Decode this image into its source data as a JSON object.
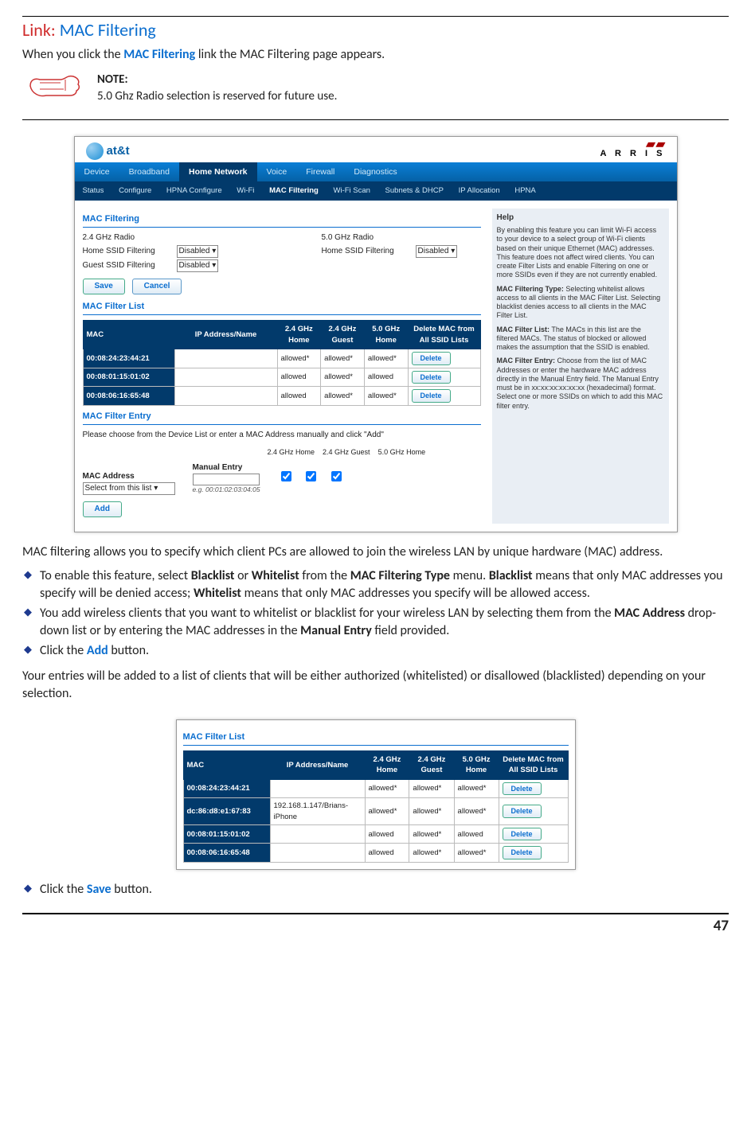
{
  "page": {
    "heading_prefix": "Link:",
    "heading_title": "MAC Filtering",
    "intro_a": "When you click the ",
    "intro_link": "MAC Filtering",
    "intro_b": " link the MAC Filtering page appears.",
    "note_label": "NOTE:",
    "note_text": "5.0 Ghz Radio selection is reserved for future use.",
    "body_p1": "MAC filtering allows you to specify which client PCs are allowed to join the wireless LAN by unique hardware (MAC) address.",
    "bullets": [
      {
        "pre": "To enable this feature, select ",
        "b1": "Blacklist",
        "mid1": " or ",
        "b2": "Whitelist",
        "mid2": " from the ",
        "b3": "MAC Filtering Type",
        "mid3": " menu. ",
        "b4": "Blacklist",
        "mid4": " means that only MAC addresses you specify will be denied access; ",
        "b5": "Whitelist",
        "mid5": " means that only MAC addresses you specify will be allowed access."
      },
      {
        "pre": "You add wireless clients that you want to whitelist or blacklist for your wireless LAN by selecting them from the ",
        "b1": "MAC Address",
        "mid1": " drop-down list or by entering the MAC addresses in the ",
        "b2": "Manual Entry",
        "mid2": " field provided."
      },
      {
        "pre": "Click the ",
        "link": "Add",
        "post": " button."
      }
    ],
    "body_p2": "Your entries will be added to a list of clients that will be either authorized (whitelisted) or disallowed (blacklisted) depending on your selection.",
    "bullet_save_pre": "Click the ",
    "bullet_save_link": "Save",
    "bullet_save_post": " button.",
    "page_number": "47"
  },
  "screenshot": {
    "brand_left": "at&t",
    "brand_right": "A R R I S",
    "tabs": [
      "Device",
      "Broadband",
      "Home Network",
      "Voice",
      "Firewall",
      "Diagnostics"
    ],
    "active_tab": "Home Network",
    "subtabs": [
      "Status",
      "Configure",
      "HPNA Configure",
      "Wi-Fi",
      "MAC Filtering",
      "Wi-Fi Scan",
      "Subnets & DHCP",
      "IP Allocation",
      "HPNA"
    ],
    "active_subtab": "MAC Filtering",
    "sections": {
      "filtering_title": "MAC Filtering",
      "radio24": "2.4 GHz Radio",
      "radio50": "5.0 GHz Radio",
      "home_ssid": "Home SSID Filtering",
      "guest_ssid": "Guest SSID Filtering",
      "disabled": "Disabled ▾",
      "save": "Save",
      "cancel": "Cancel",
      "filterlist_title": "MAC Filter List",
      "columns": [
        "MAC",
        "IP Address/Name",
        "2.4 GHz Home",
        "2.4 GHz Guest",
        "5.0 GHz Home",
        "Delete MAC from All SSID Lists"
      ],
      "rows": [
        {
          "mac": "00:08:24:23:44:21",
          "ip": "",
          "c1": "allowed*",
          "c2": "allowed*",
          "c3": "allowed*"
        },
        {
          "mac": "00:08:01:15:01:02",
          "ip": "",
          "c1": "allowed",
          "c2": "allowed*",
          "c3": "allowed"
        },
        {
          "mac": "00:08:06:16:65:48",
          "ip": "",
          "c1": "allowed",
          "c2": "allowed*",
          "c3": "allowed*"
        }
      ],
      "delete": "Delete",
      "filterentry_title": "MAC Filter Entry",
      "filterentry_instr": "Please choose from the Device List or enter a MAC Address manually and click \"Add\"",
      "macaddr_label": "MAC Address",
      "manual_label": "Manual Entry",
      "cb24h": "2.4 GHz Home",
      "cb24g": "2.4 GHz Guest",
      "cb50h": "5.0 GHz Home",
      "select_default": "Select from this list",
      "hint": "e.g. 00:01:02:03:04:05",
      "add": "Add"
    },
    "help": {
      "title": "Help",
      "p1": "By enabling this feature you can limit Wi-Fi access to your device to a select group of Wi-Fi clients based on their unique Ethernet (MAC) addresses. This feature does not affect wired clients. You can create Filter Lists and enable Filtering on one or more SSIDs even if they are not currently enabled.",
      "p2_label": "MAC Filtering Type:",
      "p2": " Selecting whitelist allows access to all clients in the MAC Filter List. Selecting blacklist denies access to all clients in the MAC Filter List.",
      "p3_label": "MAC Filter List:",
      "p3": " The MACs in this list are the filtered MACs. The status of blocked or allowed makes the assumption that the SSID is enabled.",
      "p4_label": "MAC Filter Entry:",
      "p4": " Choose from the list of MAC Addresses or enter the hardware MAC address directly in the Manual Entry field. The Manual Entry must be in xx:xx:xx:xx:xx:xx (hexadecimal) format. Select one or more SSIDs on which to add this MAC filter entry."
    }
  },
  "screenshot2": {
    "title": "MAC Filter List",
    "columns": [
      "MAC",
      "IP Address/Name",
      "2.4 GHz Home",
      "2.4 GHz Guest",
      "5.0 GHz Home",
      "Delete MAC from All SSID Lists"
    ],
    "rows": [
      {
        "mac": "00:08:24:23:44:21",
        "ip": "",
        "c1": "allowed*",
        "c2": "allowed*",
        "c3": "allowed*"
      },
      {
        "mac": "dc:86:d8:e1:67:83",
        "ip": "192.168.1.147/Brians-iPhone",
        "c1": "allowed*",
        "c2": "allowed*",
        "c3": "allowed*"
      },
      {
        "mac": "00:08:01:15:01:02",
        "ip": "",
        "c1": "allowed",
        "c2": "allowed*",
        "c3": "allowed"
      },
      {
        "mac": "00:08:06:16:65:48",
        "ip": "",
        "c1": "allowed",
        "c2": "allowed*",
        "c3": "allowed*"
      }
    ],
    "delete": "Delete"
  }
}
